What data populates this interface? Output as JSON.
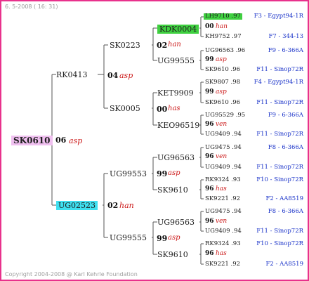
{
  "header": "6. 5-2008 ( 16: 31)",
  "footer": "Copyright 2004-2008 @ Karl Kehrle Foundation",
  "root": {
    "name": "SK0610",
    "id": "06",
    "gen": "asp"
  },
  "gen1": [
    {
      "name": "RK0413",
      "id": "04",
      "gen": "asp"
    },
    {
      "name": "UG02523",
      "id": "02",
      "gen": "han"
    }
  ],
  "gen2": [
    {
      "name": "SK0223",
      "id": "02",
      "gen": "han"
    },
    {
      "name": "SK0005",
      "id": "00",
      "gen": "has"
    },
    {
      "name": "UG99553",
      "id": "99",
      "gen": "asp"
    },
    {
      "name": "UG99555",
      "id": "99",
      "gen": "asp"
    }
  ],
  "gen3": [
    {
      "name": "KDK0004",
      "id": "00",
      "gen": "han"
    },
    {
      "name": "UG99555",
      "id": "99",
      "gen": "asp"
    },
    {
      "name": "KET9909",
      "id": "99",
      "gen": "asp"
    },
    {
      "name": "KEO96519",
      "id": "96",
      "gen": "ven"
    },
    {
      "name": "UG96563",
      "id": "96",
      "gen": "ven"
    },
    {
      "name": "SK9610",
      "id": "96",
      "gen": "has"
    },
    {
      "name": "UG96563",
      "id": "96",
      "gen": "ven"
    },
    {
      "name": "SK9610",
      "id": "96",
      "gen": "has"
    }
  ],
  "gen4": [
    {
      "code": "LH9710 .97",
      "origin": "F3 - Egypt94-1R"
    },
    {
      "code": "KH9752 .97",
      "origin": "F7 - 344-13"
    },
    {
      "code": "UG96563 .96",
      "origin": "F9 - 6-366A"
    },
    {
      "code": "SK9610 .96",
      "origin": "F11 - Sinop72R"
    },
    {
      "code": "SK9807 .98",
      "origin": "F4 - Egypt94-1R"
    },
    {
      "code": "SK9610 .96",
      "origin": "F11 - Sinop72R"
    },
    {
      "code": "UG95529 .95",
      "origin": "F9 - 6-366A"
    },
    {
      "code": "UG9409 .94",
      "origin": "F11 - Sinop72R"
    },
    {
      "code": "UG9475 .94",
      "origin": "F8 - 6-366A"
    },
    {
      "code": "UG9409 .94",
      "origin": "F11 - Sinop72R"
    },
    {
      "code": "RK9324 .93",
      "origin": "F10 - Sinop72R"
    },
    {
      "code": "SK9221 .92",
      "origin": "F2 - AA8519"
    },
    {
      "code": "UG9475 .94",
      "origin": "F8 - 6-366A"
    },
    {
      "code": "UG9409 .94",
      "origin": "F11 - Sinop72R"
    },
    {
      "code": "RK9324 .93",
      "origin": "F10 - Sinop72R"
    },
    {
      "code": "SK9221 .92",
      "origin": "F2 - AA8519"
    }
  ],
  "colors": {
    "frame": "#e8318c",
    "root_box": "#f0c0f0",
    "sire_box": "#3fe0f0",
    "highlight_box": "#3fd040",
    "gen_text": "#cc1a1a",
    "origin_text": "#1730c8"
  }
}
